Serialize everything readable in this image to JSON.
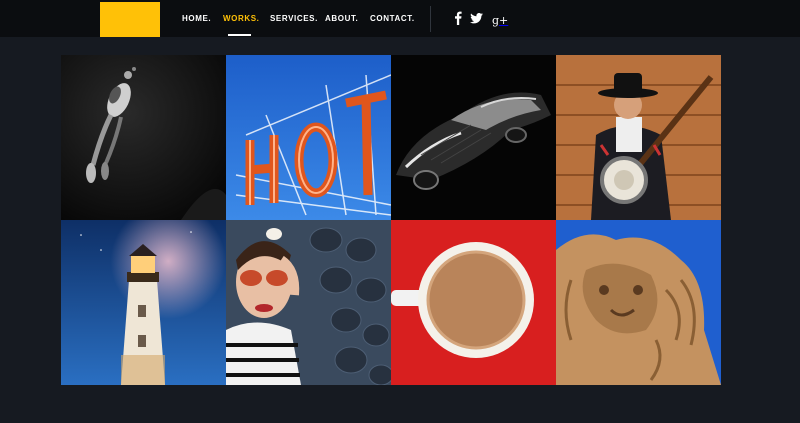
{
  "nav": {
    "items": [
      {
        "label": "HOME."
      },
      {
        "label": "WORKS.",
        "active": true
      },
      {
        "label": "SERVICES."
      },
      {
        "label": "ABOUT."
      },
      {
        "label": "CONTACT."
      }
    ]
  },
  "social": {
    "facebook_icon": "f",
    "twitter_icon": "twitter-bird",
    "gplus_icon": "g+"
  },
  "colors": {
    "accent": "#ffc107",
    "background": "#161a21",
    "header": "#0b0d10"
  },
  "gallery": [
    {
      "name": "scuba-diver"
    },
    {
      "name": "hotel-neon-sign"
    },
    {
      "name": "vintage-car"
    },
    {
      "name": "banjo-player"
    },
    {
      "name": "lighthouse"
    },
    {
      "name": "woman-sunglasses"
    },
    {
      "name": "coffee-cup"
    },
    {
      "name": "lion-statue"
    }
  ]
}
